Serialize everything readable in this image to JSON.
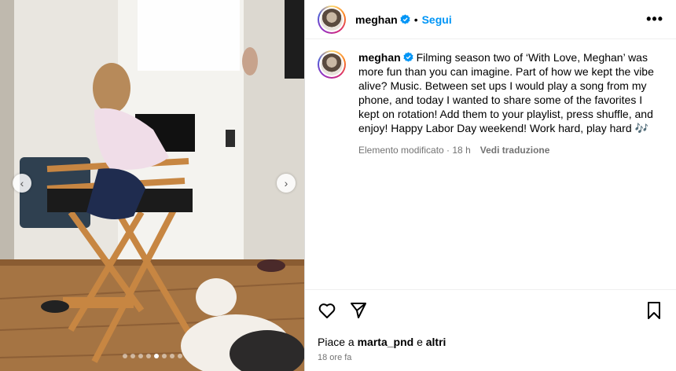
{
  "post": {
    "username": "meghan",
    "follow_label": "Segui",
    "separator": "•",
    "more_label": "•••",
    "caption": "Filming season two of ‘With Love, Meghan’ was more fun than you can imagine. Part of how we kept the vibe alive? Music. Between set ups I would play a song from my phone, and today I wanted to share some of the favorites I kept on rotation! Add them to your playlist, press shuffle, and enjoy! Happy Labor Day weekend! Work hard, play hard 🎶",
    "edited_label": "Elemento modificato · 18 h",
    "translate_label": "Vedi traduzione",
    "likes_prefix": "Piace a",
    "likes_user": "marta_pnd",
    "likes_suffix": "e altri",
    "posted_time": "18 ore fa"
  },
  "carousel": {
    "prev_icon": "chevron-left-icon",
    "next_icon": "chevron-right-icon",
    "slides": 8,
    "active": 4
  },
  "colors": {
    "accent": "#0095f6",
    "verified": "#0095f6",
    "muted": "#737373"
  }
}
